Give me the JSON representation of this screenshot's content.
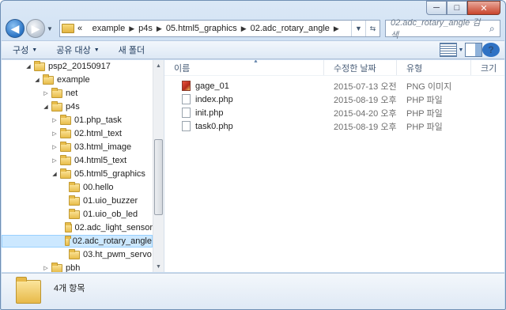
{
  "window": {
    "caption_min": "─",
    "caption_max": "□",
    "caption_close": "✕"
  },
  "nav": {
    "back_glyph": "◀",
    "forward_glyph": "▶",
    "history_glyph": "▼",
    "address_prefix": "«",
    "breadcrumb": [
      "example",
      "p4s",
      "05.html5_graphics",
      "02.adc_rotary_angle"
    ],
    "address_dropdown_glyph": "▼",
    "refresh_glyph": "⇆",
    "search_placeholder": "02.adc_rotary_angle 검색",
    "search_icon": "search-icon"
  },
  "toolbar": {
    "organize_label": "구성",
    "share_label": "공유 대상",
    "new_folder_label": "새 폴더",
    "help_glyph": "?"
  },
  "tree": [
    {
      "label": "psp2_20150917",
      "indent": 1,
      "expanded": true
    },
    {
      "label": "example",
      "indent": 2,
      "expanded": true
    },
    {
      "label": "net",
      "indent": 3,
      "expanded": false
    },
    {
      "label": "p4s",
      "indent": 3,
      "expanded": true
    },
    {
      "label": "01.php_task",
      "indent": 4,
      "expanded": false
    },
    {
      "label": "02.html_text",
      "indent": 4,
      "expanded": false
    },
    {
      "label": "03.html_image",
      "indent": 4,
      "expanded": false
    },
    {
      "label": "04.html5_text",
      "indent": 4,
      "expanded": false
    },
    {
      "label": "05.html5_graphics",
      "indent": 4,
      "expanded": true
    },
    {
      "label": "00.hello",
      "indent": 5,
      "expanded": null
    },
    {
      "label": "01.uio_buzzer",
      "indent": 5,
      "expanded": null
    },
    {
      "label": "01.uio_ob_led",
      "indent": 5,
      "expanded": null
    },
    {
      "label": "02.adc_light_sensor",
      "indent": 5,
      "expanded": null
    },
    {
      "label": "02.adc_rotary_angle",
      "indent": 5,
      "expanded": null,
      "selected": true
    },
    {
      "label": "03.ht_pwm_servo",
      "indent": 5,
      "expanded": null
    },
    {
      "label": "pbh",
      "indent": 3,
      "expanded": false
    }
  ],
  "columns": {
    "name": "이름",
    "modified": "수정한 날짜",
    "type": "유형",
    "size": "크기"
  },
  "files": [
    {
      "name": "gage_01",
      "modified": "2015-07-13 오전 9...",
      "type": "PNG 이미지",
      "icon": "png"
    },
    {
      "name": "index.php",
      "modified": "2015-08-19 오후 4...",
      "type": "PHP 파일",
      "icon": "php"
    },
    {
      "name": "init.php",
      "modified": "2015-04-20 오후 5...",
      "type": "PHP 파일",
      "icon": "php"
    },
    {
      "name": "task0.php",
      "modified": "2015-08-19 오후 4...",
      "type": "PHP 파일",
      "icon": "php"
    }
  ],
  "status": {
    "item_count": "4개 항목"
  }
}
